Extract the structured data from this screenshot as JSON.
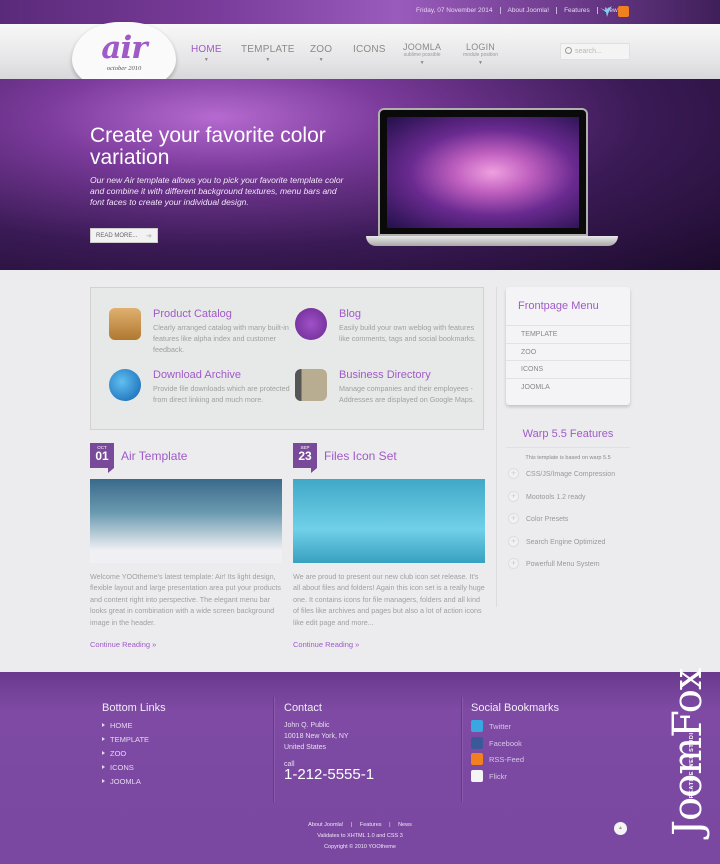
{
  "topbar": {
    "date": "Friday, 07 November 2014",
    "links": [
      "About Joomla!",
      "Features",
      "News"
    ],
    "icons": [
      "twitter-bird-icon",
      "rss-icon"
    ]
  },
  "logo": {
    "name": "air",
    "subtitle": "october 2010"
  },
  "nav": [
    {
      "label": "HOME",
      "sub": "",
      "active": true
    },
    {
      "label": "TEMPLATE",
      "sub": ""
    },
    {
      "label": "ZOO",
      "sub": ""
    },
    {
      "label": "ICONS",
      "sub": ""
    },
    {
      "label": "JOOMLA",
      "sub": "sublime possible"
    },
    {
      "label": "LOGIN",
      "sub": "module position"
    }
  ],
  "search": {
    "placeholder": "search..."
  },
  "hero": {
    "title": "Create your favorite color variation",
    "text": "Our new Air template allows you to pick your favorite template color and combine it with different background textures, menu bars and font faces to create your individual design.",
    "button": "READ MORE...",
    "button_arrow": "➜"
  },
  "features": [
    {
      "title": "Product Catalog",
      "text": "Clearly arranged catalog with many built-in features like alpha index and customer feedback.",
      "icon": "box-icon"
    },
    {
      "title": "Blog",
      "text": "Easily build your own weblog with features like comments, tags and social bookmarks.",
      "icon": "inkwell-icon"
    },
    {
      "title": "Download Archive",
      "text": "Provide file downloads which are protected from direct linking and much more.",
      "icon": "globe-download-icon"
    },
    {
      "title": "Business Directory",
      "text": "Manage companies and their employees - Addresses are displayed on Google Maps.",
      "icon": "address-book-icon"
    }
  ],
  "posts": [
    {
      "month": "OCT",
      "day": "01",
      "title": "Air Template",
      "text": "Welcome YOOtheme's latest template: Air! Its light design, flexible layout and large presentation area put your products and content right into perspective. The elegant menu bar looks great in combination with a wide screen background image in the header.",
      "link": "Continue Reading »"
    },
    {
      "month": "SEP",
      "day": "23",
      "title": "Files Icon Set",
      "text": "We are proud to present our new club icon set release. It's all about files and folders! Again this icon set is a really huge one. It contains icons for file managers, folders and all kind of files like archives and pages but also a lot of action icons like edit page and more...",
      "link": "Continue Reading »"
    }
  ],
  "frontpage_menu": {
    "title": "Frontpage Menu",
    "items": [
      "TEMPLATE",
      "ZOO",
      "ICONS",
      "JOOMLA"
    ]
  },
  "warp": {
    "title": "Warp 5.5 Features",
    "subtitle": "This template is based on warp 5.5",
    "items": [
      "CSS/JS/Image Compression",
      "Mootools 1.2 ready",
      "Color Presets",
      "Search Engine Optimized",
      "Powerfull Menu System"
    ]
  },
  "footer": {
    "bottom_links": {
      "title": "Bottom Links",
      "items": [
        "HOME",
        "TEMPLATE",
        "ZOO",
        "ICONS",
        "JOOMLA"
      ]
    },
    "contact": {
      "title": "Contact",
      "lines": [
        "John Q. Public",
        "10018 New York, NY",
        "United States"
      ],
      "call_label": "call",
      "phone": "1-212-5555-1"
    },
    "social": {
      "title": "Social Bookmarks",
      "items": [
        {
          "label": "Twitter",
          "color": "#3aa8e0"
        },
        {
          "label": "Facebook",
          "color": "#3b5998"
        },
        {
          "label": "RSS-Feed",
          "color": "#f08020"
        },
        {
          "label": "Flickr",
          "color": "#f4f4f4"
        }
      ]
    },
    "links": [
      "About Joomla!",
      "Features",
      "News"
    ],
    "validates": "Validates to XHTML 1.0 and CSS 3",
    "copyright": "Copyright © 2010 YOOtheme",
    "brand": "JoomFox",
    "brand_tagline": "CREATIVE WEB STUDIO"
  },
  "colors": {
    "accent": "#a05ac8",
    "footer_bg": "#7a48a0"
  }
}
